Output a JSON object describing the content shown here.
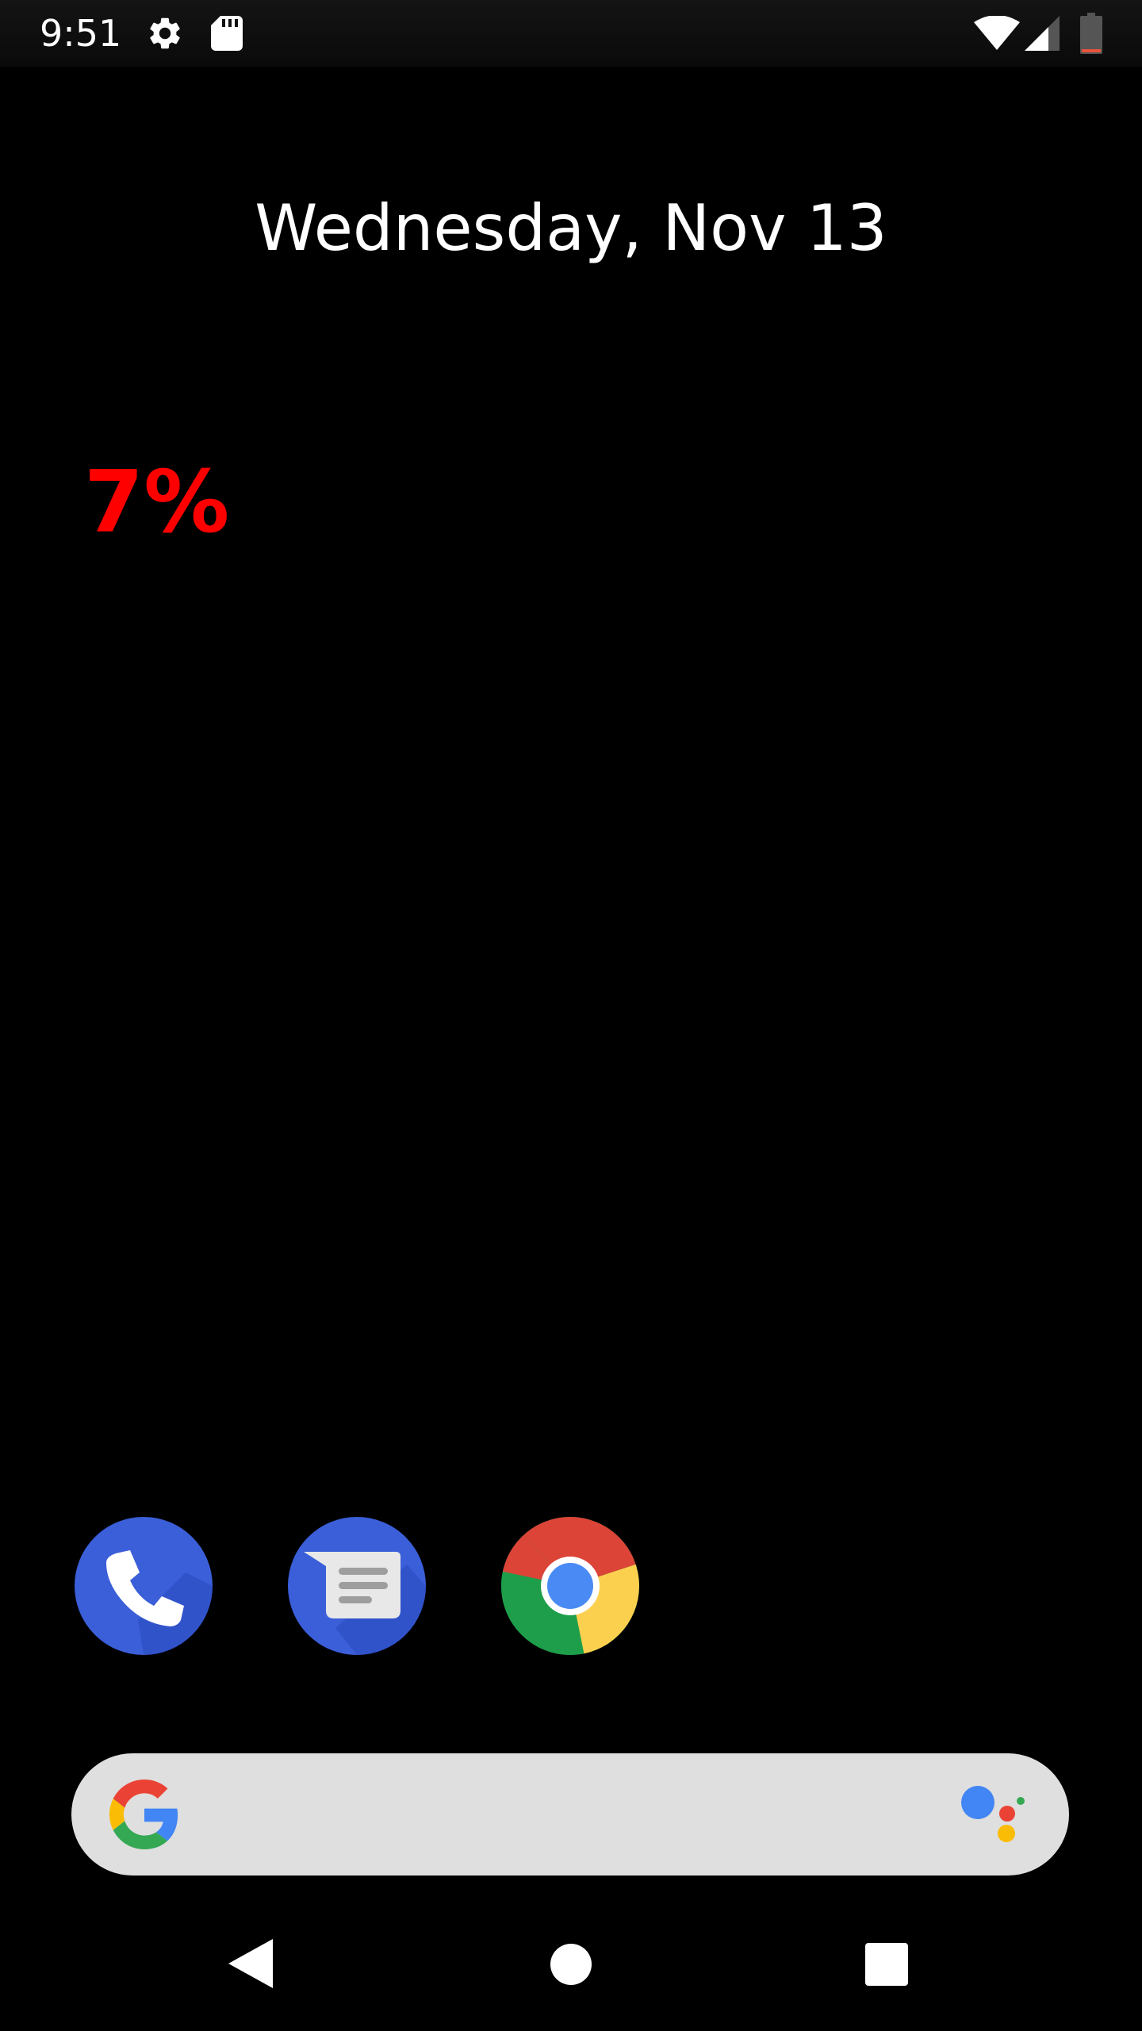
{
  "status_bar": {
    "time": "9:51",
    "icons": [
      "gear-icon",
      "sd-card-icon",
      "wifi-icon",
      "cell-signal-icon",
      "battery-icon"
    ]
  },
  "home": {
    "date": "Wednesday, Nov 13",
    "percent_widget": {
      "text": "7%",
      "color": "#ff0000"
    }
  },
  "dock": {
    "apps": [
      {
        "name": "Phone",
        "icon": "phone-icon"
      },
      {
        "name": "Messages",
        "icon": "messages-icon"
      },
      {
        "name": "Chrome",
        "icon": "chrome-icon"
      }
    ]
  },
  "search_bar": {
    "left_icon": "google-g-icon",
    "right_icon": "google-assistant-icon"
  },
  "nav_bar": {
    "buttons": [
      "back-icon",
      "home-icon",
      "recents-icon"
    ]
  },
  "colors": {
    "background": "#000000",
    "search_bar": "#dfdfdf",
    "accent_blue": "#3b5fd9",
    "battery_low": "#e8533a"
  }
}
